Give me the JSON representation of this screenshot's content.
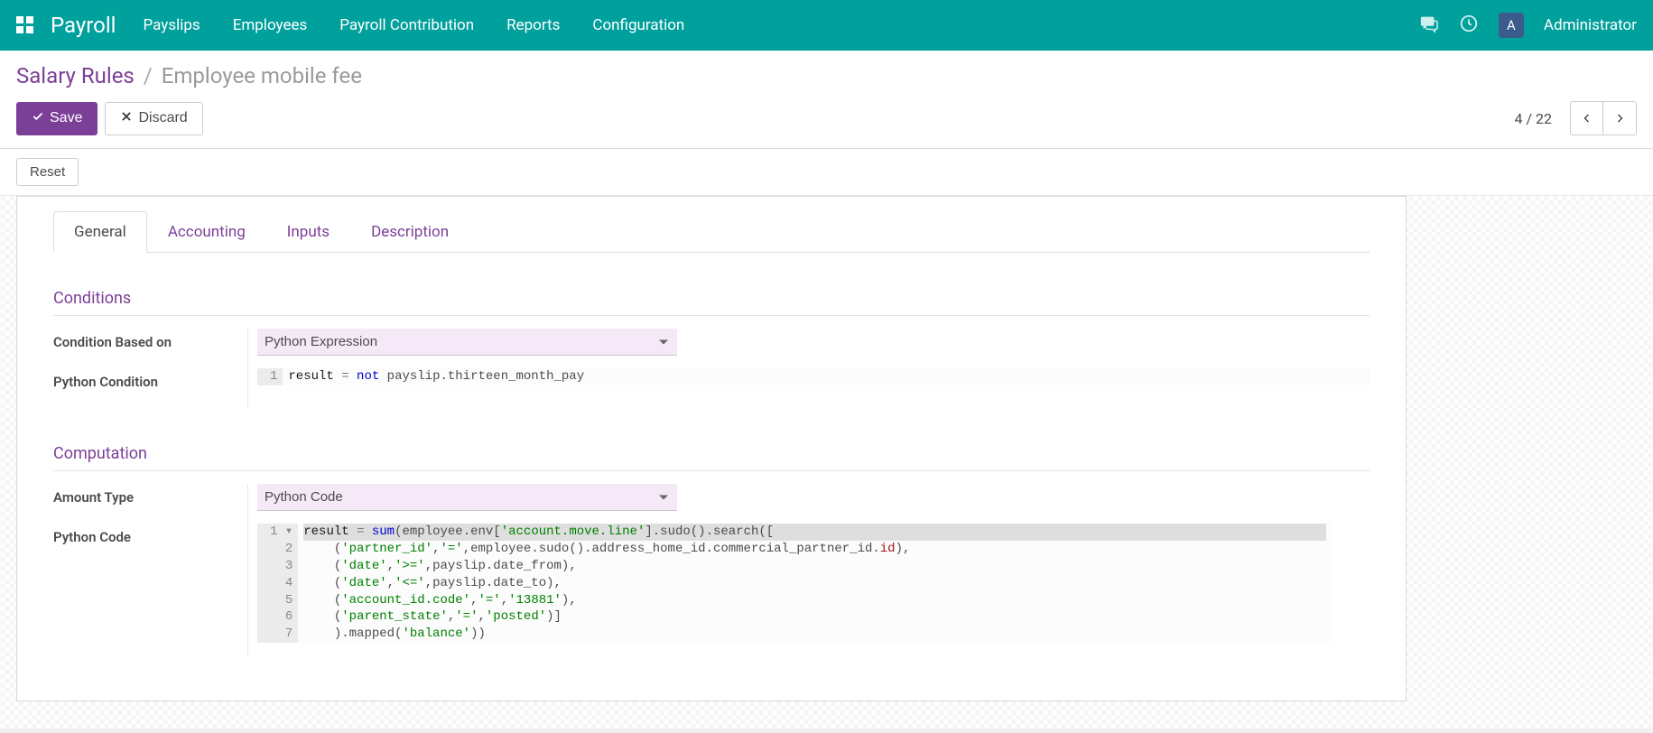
{
  "nav": {
    "brand": "Payroll",
    "menu": [
      "Payslips",
      "Employees",
      "Payroll Contribution",
      "Reports",
      "Configuration"
    ],
    "user_initial": "A",
    "user_name": "Administrator"
  },
  "breadcrumb": {
    "parent": "Salary Rules",
    "sep": "/",
    "current": "Employee mobile fee"
  },
  "buttons": {
    "save": "Save",
    "discard": "Discard",
    "reset": "Reset"
  },
  "pager": {
    "text": "4 / 22"
  },
  "tabs": [
    "General",
    "Accounting",
    "Inputs",
    "Description"
  ],
  "sections": {
    "conditions": {
      "title": "Conditions",
      "condition_based_on_label": "Condition Based on",
      "condition_based_on_value": "Python Expression",
      "python_condition_label": "Python Condition",
      "python_condition_code": {
        "line_numbers": [
          "1"
        ],
        "tokens": [
          [
            {
              "t": "id",
              "v": "result"
            },
            {
              "t": "txt",
              "v": " "
            },
            {
              "t": "op",
              "v": "="
            },
            {
              "t": "txt",
              "v": " "
            },
            {
              "t": "kw",
              "v": "not"
            },
            {
              "t": "txt",
              "v": " payslip.thirteen_month_pay"
            }
          ]
        ]
      }
    },
    "computation": {
      "title": "Computation",
      "amount_type_label": "Amount Type",
      "amount_type_value": "Python Code",
      "python_code_label": "Python Code",
      "python_code": {
        "line_numbers": [
          "1",
          "2",
          "3",
          "4",
          "5",
          "6",
          "7"
        ],
        "fold_line": 1,
        "tokens": [
          [
            {
              "t": "id",
              "v": "result"
            },
            {
              "t": "txt",
              "v": " "
            },
            {
              "t": "op",
              "v": "="
            },
            {
              "t": "txt",
              "v": " "
            },
            {
              "t": "kw",
              "v": "sum"
            },
            {
              "t": "txt",
              "v": "(employee.env["
            },
            {
              "t": "str",
              "v": "'account.move.line'"
            },
            {
              "t": "txt",
              "v": "].sudo().search(["
            }
          ],
          [
            {
              "t": "txt",
              "v": "    ("
            },
            {
              "t": "str",
              "v": "'partner_id'"
            },
            {
              "t": "txt",
              "v": ","
            },
            {
              "t": "str",
              "v": "'='"
            },
            {
              "t": "txt",
              "v": ",employee.sudo().address_home_id.commercial_partner_id."
            },
            {
              "t": "attr",
              "v": "id"
            },
            {
              "t": "txt",
              "v": "),"
            }
          ],
          [
            {
              "t": "txt",
              "v": "    ("
            },
            {
              "t": "str",
              "v": "'date'"
            },
            {
              "t": "txt",
              "v": ","
            },
            {
              "t": "str",
              "v": "'>='"
            },
            {
              "t": "txt",
              "v": ",payslip.date_from),"
            }
          ],
          [
            {
              "t": "txt",
              "v": "    ("
            },
            {
              "t": "str",
              "v": "'date'"
            },
            {
              "t": "txt",
              "v": ","
            },
            {
              "t": "str",
              "v": "'<='"
            },
            {
              "t": "txt",
              "v": ",payslip.date_to),"
            }
          ],
          [
            {
              "t": "txt",
              "v": "    ("
            },
            {
              "t": "str",
              "v": "'account_id.code'"
            },
            {
              "t": "txt",
              "v": ","
            },
            {
              "t": "str",
              "v": "'='"
            },
            {
              "t": "txt",
              "v": ","
            },
            {
              "t": "str",
              "v": "'13881'"
            },
            {
              "t": "txt",
              "v": "),"
            }
          ],
          [
            {
              "t": "txt",
              "v": "    ("
            },
            {
              "t": "str",
              "v": "'parent_state'"
            },
            {
              "t": "txt",
              "v": ","
            },
            {
              "t": "str",
              "v": "'='"
            },
            {
              "t": "txt",
              "v": ","
            },
            {
              "t": "str",
              "v": "'posted'"
            },
            {
              "t": "txt",
              "v": ")]"
            }
          ],
          [
            {
              "t": "txt",
              "v": "    ).mapped("
            },
            {
              "t": "str",
              "v": "'balance'"
            },
            {
              "t": "txt",
              "v": "))"
            }
          ]
        ]
      }
    }
  }
}
